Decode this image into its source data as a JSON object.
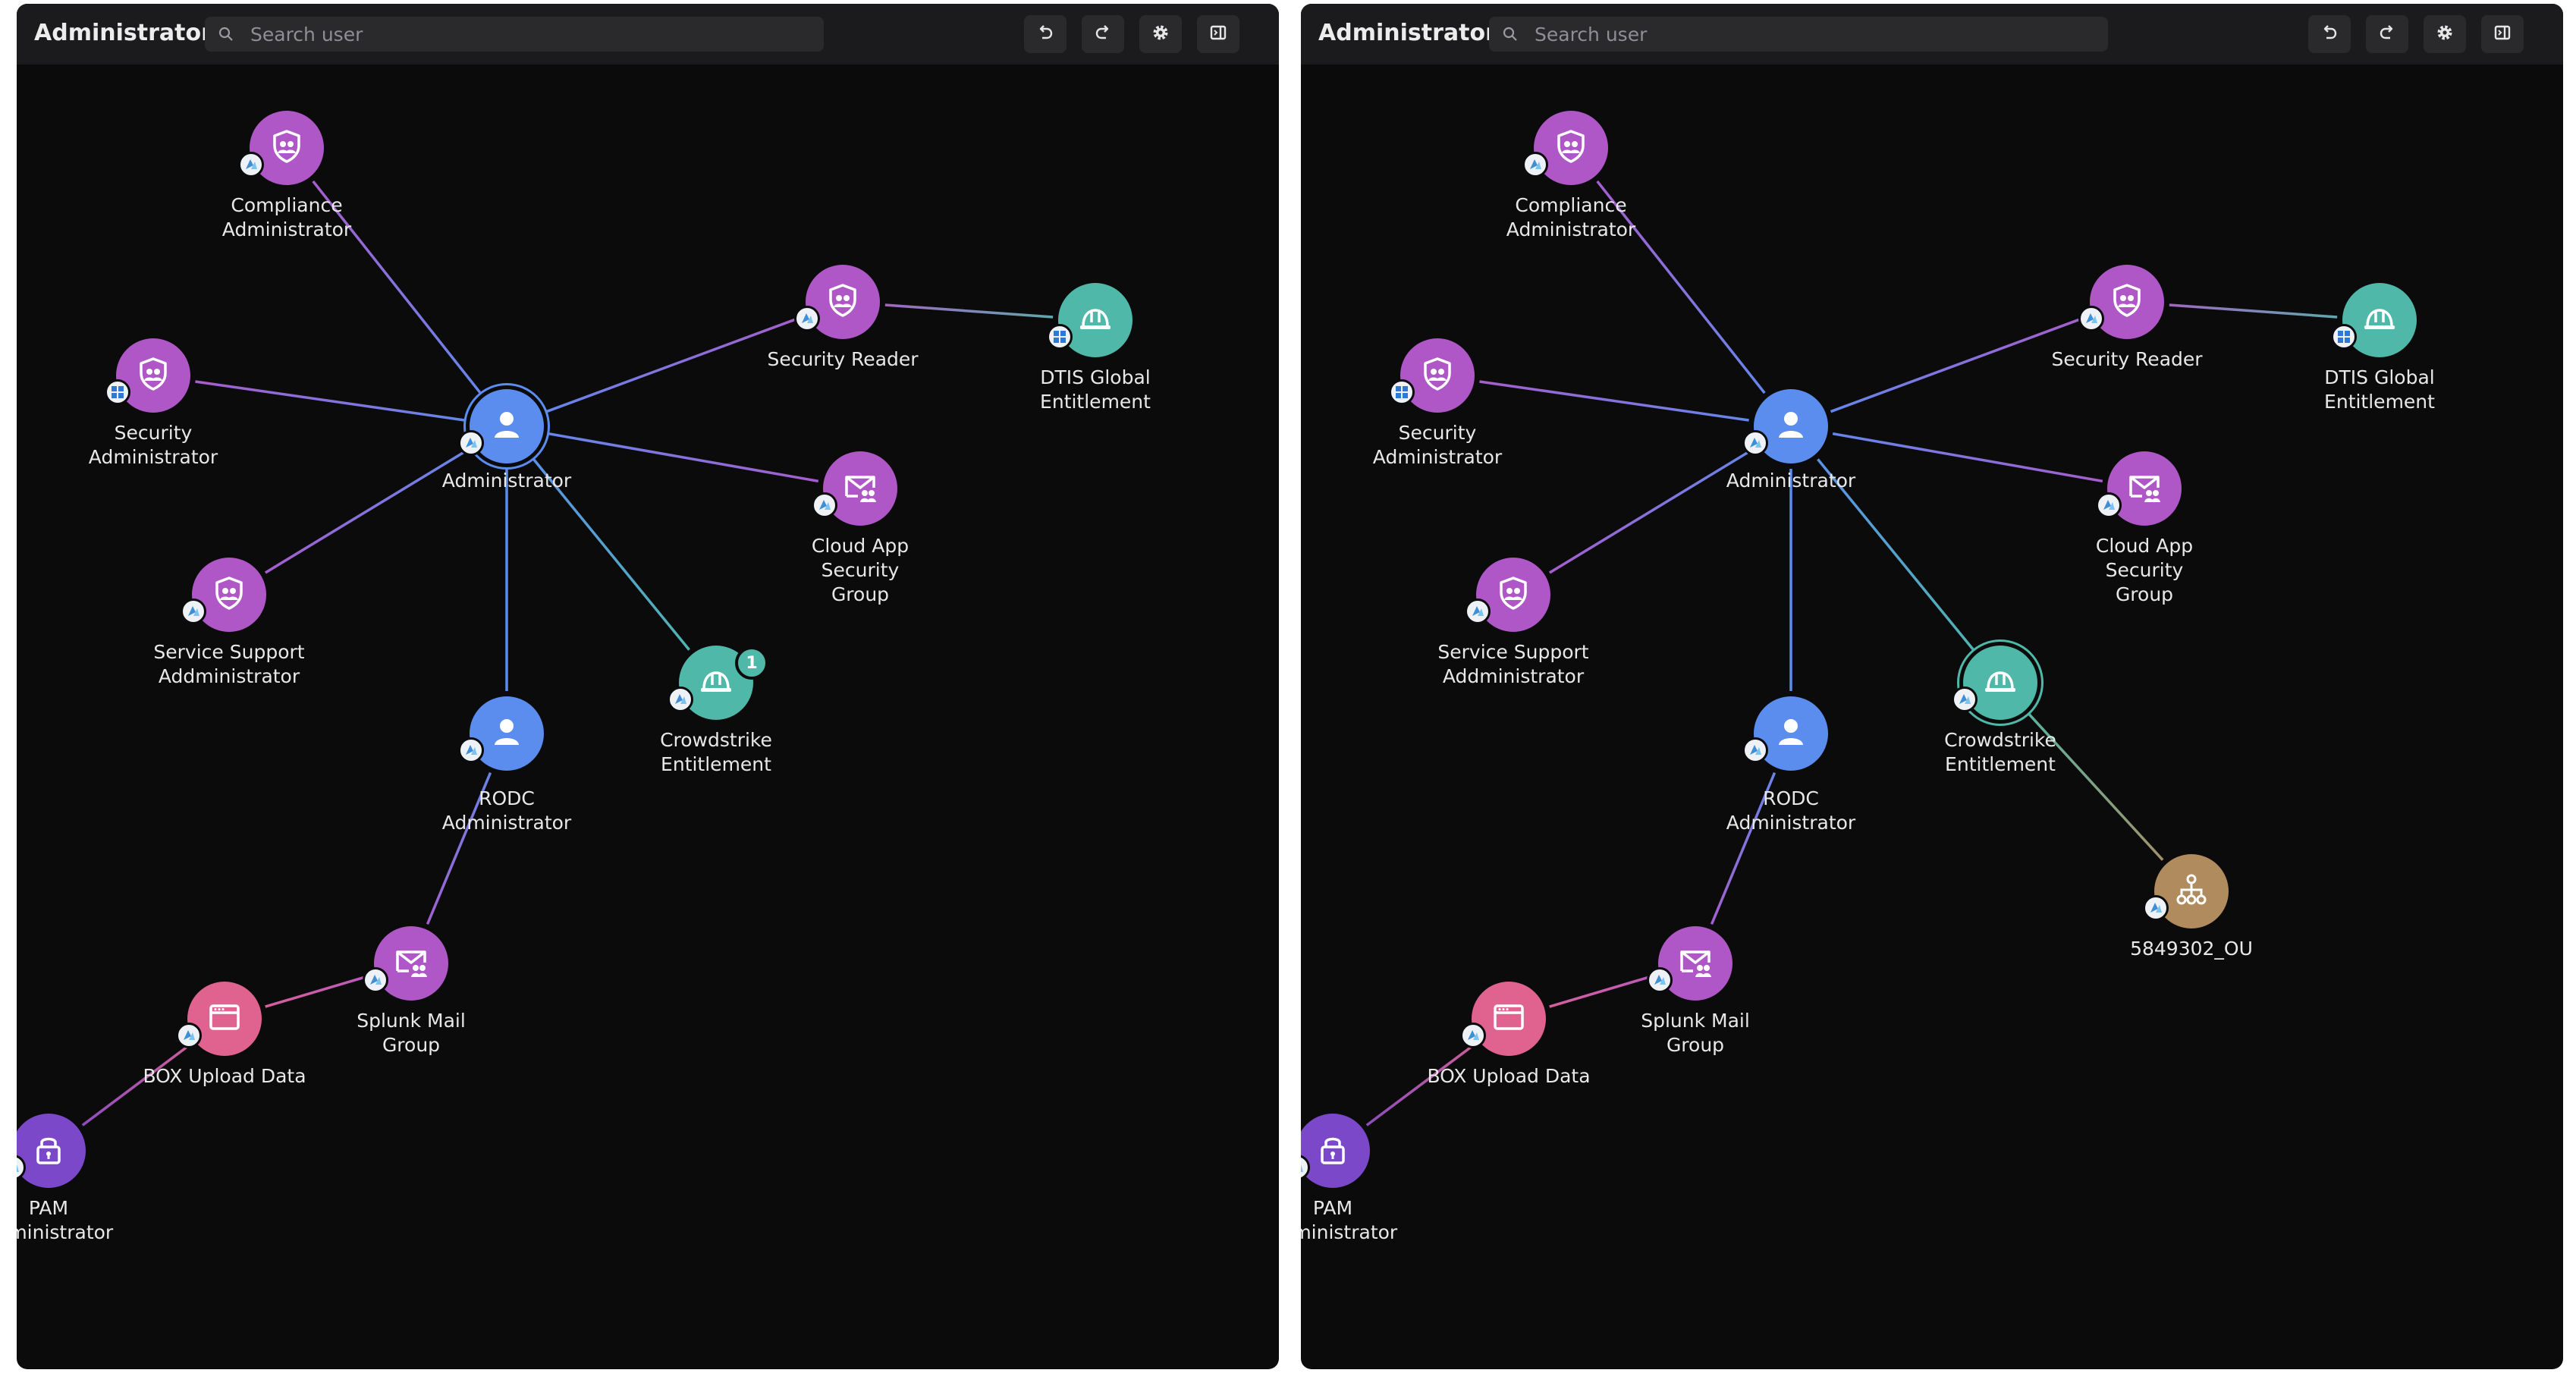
{
  "colors": {
    "panel_bg": "#0b0b0c",
    "toolbar_bg": "#1b1b1d",
    "role": "#b057c8",
    "user": "#5b8def",
    "entitlement": "#4fb8a8",
    "app": "#e0628f",
    "privileged": "#7a48c8",
    "org_unit": "#b08b5e"
  },
  "panels": [
    {
      "title": "Administrator",
      "search": {
        "placeholder": "Search user",
        "value": ""
      },
      "toolbar": [
        "undo-icon",
        "redo-icon",
        "gear-icon",
        "sidebar-panel-icon"
      ],
      "selected_node": "administrator",
      "nodes": [
        {
          "id": "compliance-administrator",
          "label": "Compliance\nAdministrator",
          "kind": "role",
          "icon": "shield-users-icon",
          "source": "azure-icon"
        },
        {
          "id": "security-reader",
          "label": "Security Reader",
          "kind": "role",
          "icon": "shield-users-icon",
          "source": "azure-icon"
        },
        {
          "id": "dtis-global-entitlement",
          "label": "DTIS Global\nEntitlement",
          "kind": "entitlement",
          "icon": "hard-hat-icon",
          "source": "windows-icon"
        },
        {
          "id": "security-administrator",
          "label": "Security\nAdministrator",
          "kind": "role",
          "icon": "shield-users-icon",
          "source": "windows-icon"
        },
        {
          "id": "administrator",
          "label": "Administrator",
          "kind": "user",
          "icon": "user-icon",
          "source": "azure-icon"
        },
        {
          "id": "cloud-app-security-group",
          "label": "Cloud App\nSecurity\nGroup",
          "kind": "role",
          "icon": "mail-group-icon",
          "source": "azure-icon"
        },
        {
          "id": "service-support-addministrator",
          "label": "Service Support\nAddministrator",
          "kind": "role",
          "icon": "shield-users-icon",
          "source": "azure-icon"
        },
        {
          "id": "crowdstrike-entitlement",
          "label": "Crowdstrike\nEntitlement",
          "kind": "entitlement",
          "icon": "hard-hat-icon",
          "source": "azure-icon",
          "count": "1"
        },
        {
          "id": "rodc-administrator",
          "label": "RODC\nAdministrator",
          "kind": "user",
          "icon": "user-icon",
          "source": "azure-icon"
        },
        {
          "id": "splunk-mail-group",
          "label": "Splunk Mail\nGroup",
          "kind": "role",
          "icon": "mail-group-icon",
          "source": "azure-icon"
        },
        {
          "id": "box-upload-data",
          "label": "BOX Upload Data",
          "kind": "app",
          "icon": "browser-window-icon",
          "source": "azure-icon"
        },
        {
          "id": "pam-administrator",
          "label": "PAM\nAdministrator",
          "kind": "privileged",
          "icon": "lock-icon",
          "source": "azure-icon"
        }
      ],
      "edges": [
        [
          "administrator",
          "compliance-administrator"
        ],
        [
          "administrator",
          "security-reader"
        ],
        [
          "security-reader",
          "dtis-global-entitlement"
        ],
        [
          "administrator",
          "security-administrator"
        ],
        [
          "administrator",
          "cloud-app-security-group"
        ],
        [
          "administrator",
          "service-support-addministrator"
        ],
        [
          "administrator",
          "crowdstrike-entitlement"
        ],
        [
          "administrator",
          "rodc-administrator"
        ],
        [
          "rodc-administrator",
          "splunk-mail-group"
        ],
        [
          "splunk-mail-group",
          "box-upload-data"
        ],
        [
          "box-upload-data",
          "pam-administrator"
        ]
      ]
    },
    {
      "title": "Administrator",
      "search": {
        "placeholder": "Search user",
        "value": ""
      },
      "toolbar": [
        "undo-icon",
        "redo-icon",
        "gear-icon",
        "sidebar-panel-icon"
      ],
      "selected_node": "crowdstrike-entitlement",
      "nodes": [
        {
          "id": "compliance-administrator",
          "label": "Compliance\nAdministrator",
          "kind": "role",
          "icon": "shield-users-icon",
          "source": "azure-icon"
        },
        {
          "id": "security-reader",
          "label": "Security Reader",
          "kind": "role",
          "icon": "shield-users-icon",
          "source": "azure-icon"
        },
        {
          "id": "dtis-global-entitlement",
          "label": "DTIS Global\nEntitlement",
          "kind": "entitlement",
          "icon": "hard-hat-icon",
          "source": "windows-icon"
        },
        {
          "id": "security-administrator",
          "label": "Security\nAdministrator",
          "kind": "role",
          "icon": "shield-users-icon",
          "source": "windows-icon"
        },
        {
          "id": "administrator",
          "label": "Administrator",
          "kind": "user",
          "icon": "user-icon",
          "source": "azure-icon"
        },
        {
          "id": "cloud-app-security-group",
          "label": "Cloud App\nSecurity\nGroup",
          "kind": "role",
          "icon": "mail-group-icon",
          "source": "azure-icon"
        },
        {
          "id": "service-support-addministrator",
          "label": "Service Support\nAddministrator",
          "kind": "role",
          "icon": "shield-users-icon",
          "source": "azure-icon"
        },
        {
          "id": "crowdstrike-entitlement",
          "label": "Crowdstrike\nEntitlement",
          "kind": "entitlement",
          "icon": "hard-hat-icon",
          "source": "azure-icon"
        },
        {
          "id": "5849302-ou",
          "label": "5849302_OU",
          "kind": "org_unit",
          "icon": "org-chart-icon",
          "source": "azure-icon"
        },
        {
          "id": "rodc-administrator",
          "label": "RODC\nAdministrator",
          "kind": "user",
          "icon": "user-icon",
          "source": "azure-icon"
        },
        {
          "id": "splunk-mail-group",
          "label": "Splunk Mail\nGroup",
          "kind": "role",
          "icon": "mail-group-icon",
          "source": "azure-icon"
        },
        {
          "id": "box-upload-data",
          "label": "BOX Upload Data",
          "kind": "app",
          "icon": "browser-window-icon",
          "source": "azure-icon"
        },
        {
          "id": "pam-administrator",
          "label": "PAM\nAdministrator",
          "kind": "privileged",
          "icon": "lock-icon",
          "source": "azure-icon"
        }
      ],
      "edges": [
        [
          "administrator",
          "compliance-administrator"
        ],
        [
          "administrator",
          "security-reader"
        ],
        [
          "security-reader",
          "dtis-global-entitlement"
        ],
        [
          "administrator",
          "security-administrator"
        ],
        [
          "administrator",
          "cloud-app-security-group"
        ],
        [
          "administrator",
          "service-support-addministrator"
        ],
        [
          "administrator",
          "crowdstrike-entitlement"
        ],
        [
          "crowdstrike-entitlement",
          "5849302-ou"
        ],
        [
          "administrator",
          "rodc-administrator"
        ],
        [
          "rodc-administrator",
          "splunk-mail-group"
        ],
        [
          "splunk-mail-group",
          "box-upload-data"
        ],
        [
          "box-upload-data",
          "pam-administrator"
        ]
      ]
    }
  ]
}
